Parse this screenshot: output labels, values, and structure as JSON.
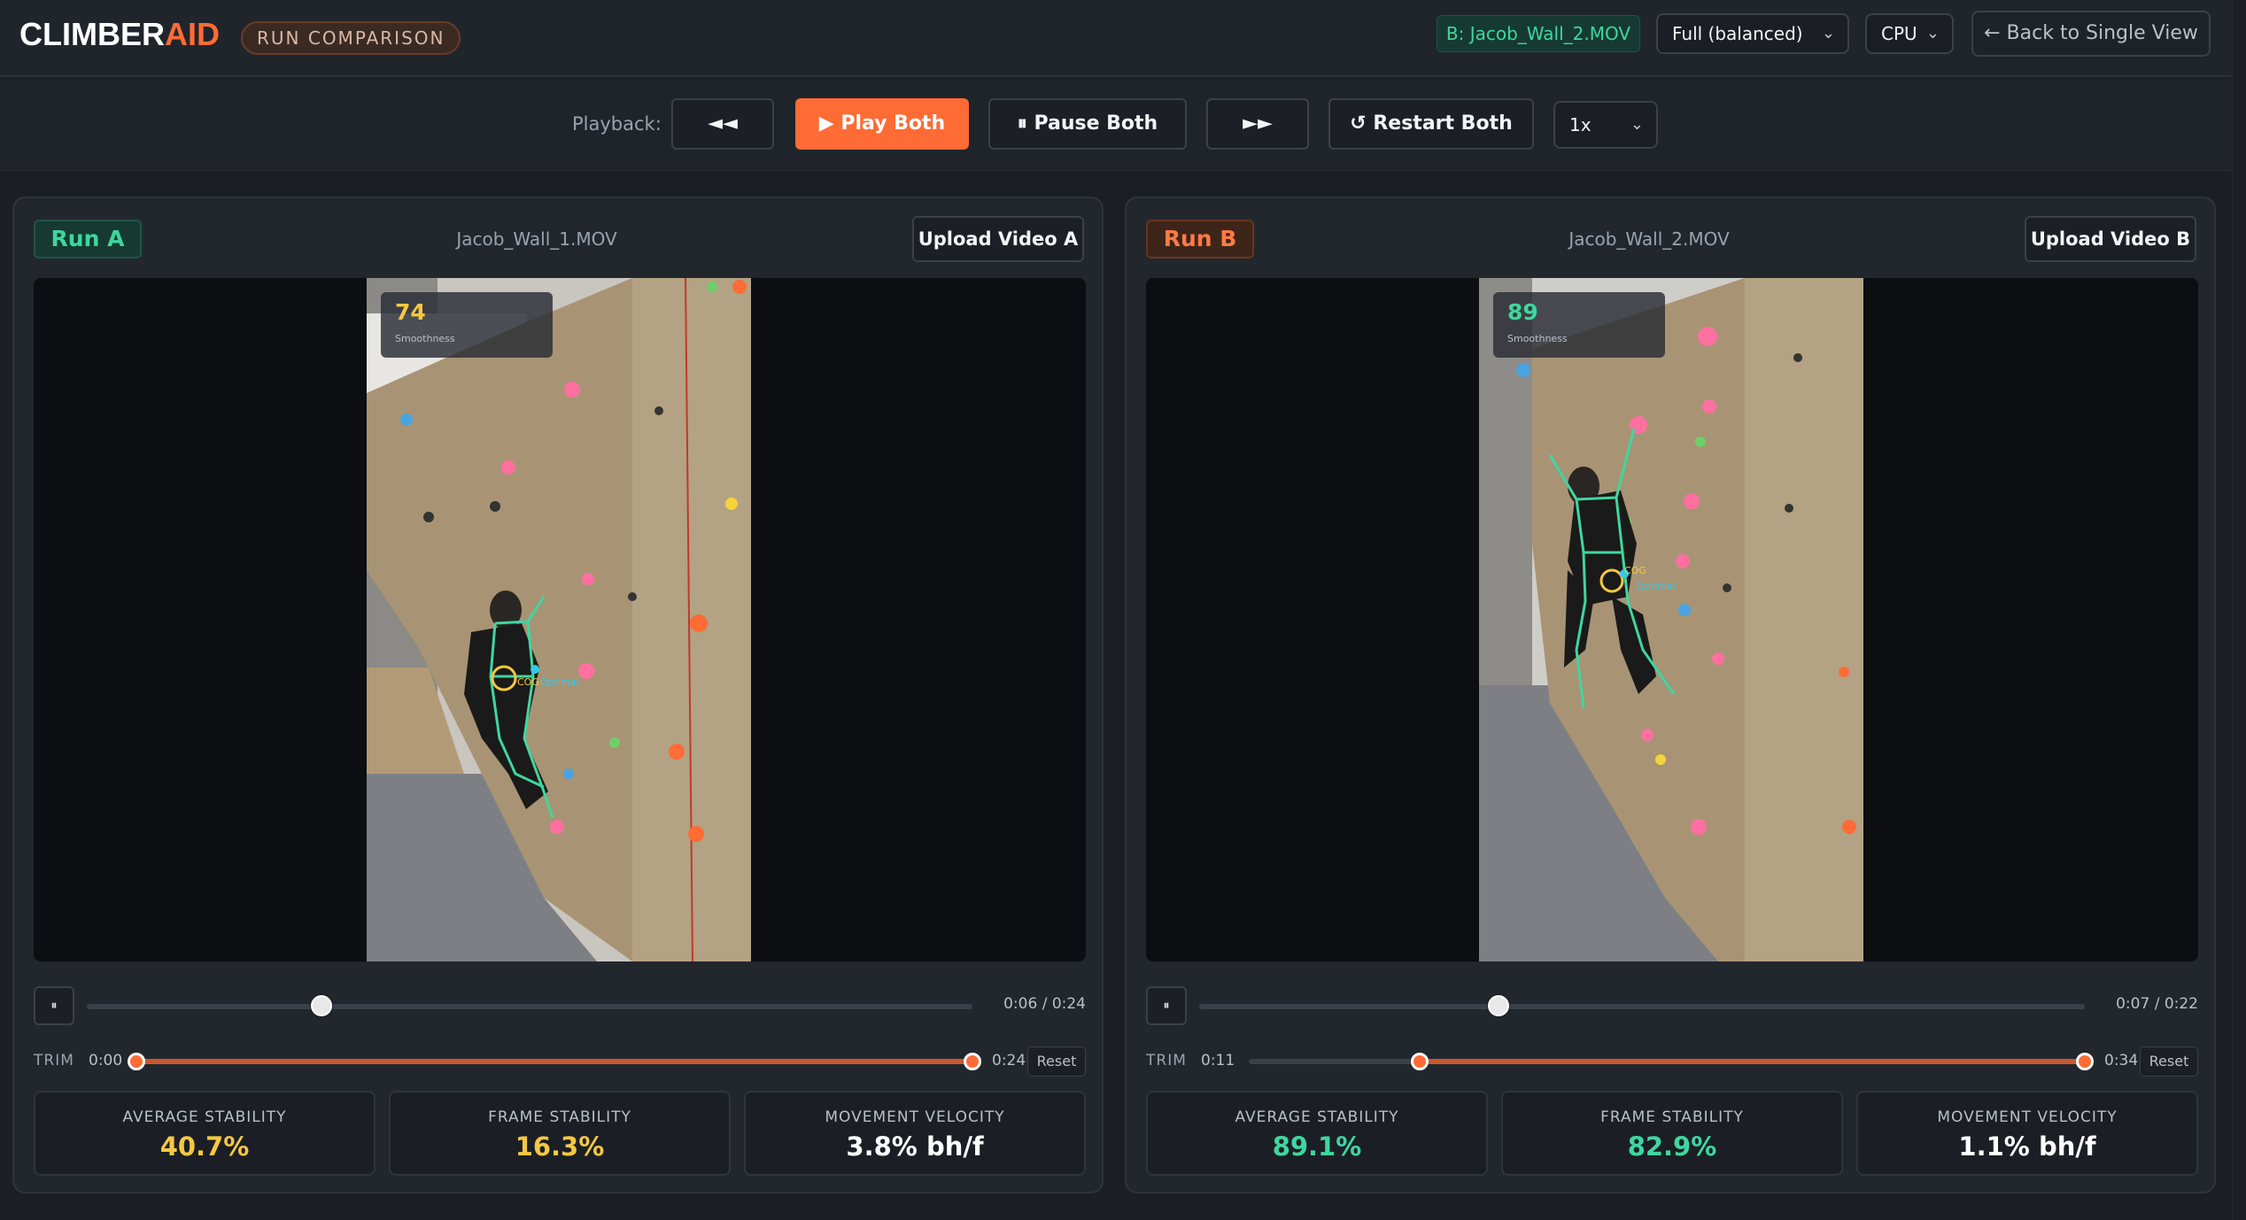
{
  "header": {
    "logo_main": "CLIMBER",
    "logo_accent": "AID",
    "mode_badge": "RUN COMPARISON",
    "video_b_chip": "B: Jacob_Wall_2.MOV",
    "quality_select": "Full (balanced)",
    "device_select": "CPU",
    "back_button": "← Back to Single View"
  },
  "playback": {
    "label": "Playback:",
    "rewind": "◄◄",
    "play_both": "▶ Play Both",
    "pause_both": "⏸ Pause Both",
    "fast_forward": "►►",
    "restart_both": "↺ Restart Both",
    "speed": "1x"
  },
  "runs": [
    {
      "tag": "Run A",
      "filename": "Jacob_Wall_1.MOV",
      "upload_label": "Upload Video A",
      "smoothness_value": "74",
      "smoothness_label": "Smoothness",
      "cog_label": "COG",
      "optimal_label": "Optimal",
      "pause_icon": "⏸",
      "time": "0:06 / 0:24",
      "seek_fraction": 0.265,
      "trim_label": "TRIM",
      "trim_start": "0:00",
      "trim_end": "0:24",
      "trim_start_fraction": 0.0,
      "trim_end_fraction": 1.0,
      "reset_label": "Reset",
      "stats": [
        {
          "title": "AVERAGE STABILITY",
          "value": "40.7%",
          "color": "#f5c842"
        },
        {
          "title": "FRAME STABILITY",
          "value": "16.3%",
          "color": "#f5c842"
        },
        {
          "title": "MOVEMENT VELOCITY",
          "value": "3.8% bh/f",
          "color": "#ffffff"
        }
      ]
    },
    {
      "tag": "Run B",
      "filename": "Jacob_Wall_2.MOV",
      "upload_label": "Upload Video B",
      "smoothness_value": "89",
      "smoothness_label": "Smoothness",
      "cog_label": "COG",
      "optimal_label": "Optimal",
      "pause_icon": "⏸",
      "time": "0:07 / 0:22",
      "seek_fraction": 0.338,
      "trim_label": "TRIM",
      "trim_start": "0:11",
      "trim_end": "0:34",
      "trim_start_fraction": 0.204,
      "trim_end_fraction": 1.0,
      "reset_label": "Reset",
      "stats": [
        {
          "title": "AVERAGE STABILITY",
          "value": "89.1%",
          "color": "#3fd6a0"
        },
        {
          "title": "FRAME STABILITY",
          "value": "82.9%",
          "color": "#3fd6a0"
        },
        {
          "title": "MOVEMENT VELOCITY",
          "value": "1.1% bh/f",
          "color": "#ffffff"
        }
      ]
    }
  ]
}
